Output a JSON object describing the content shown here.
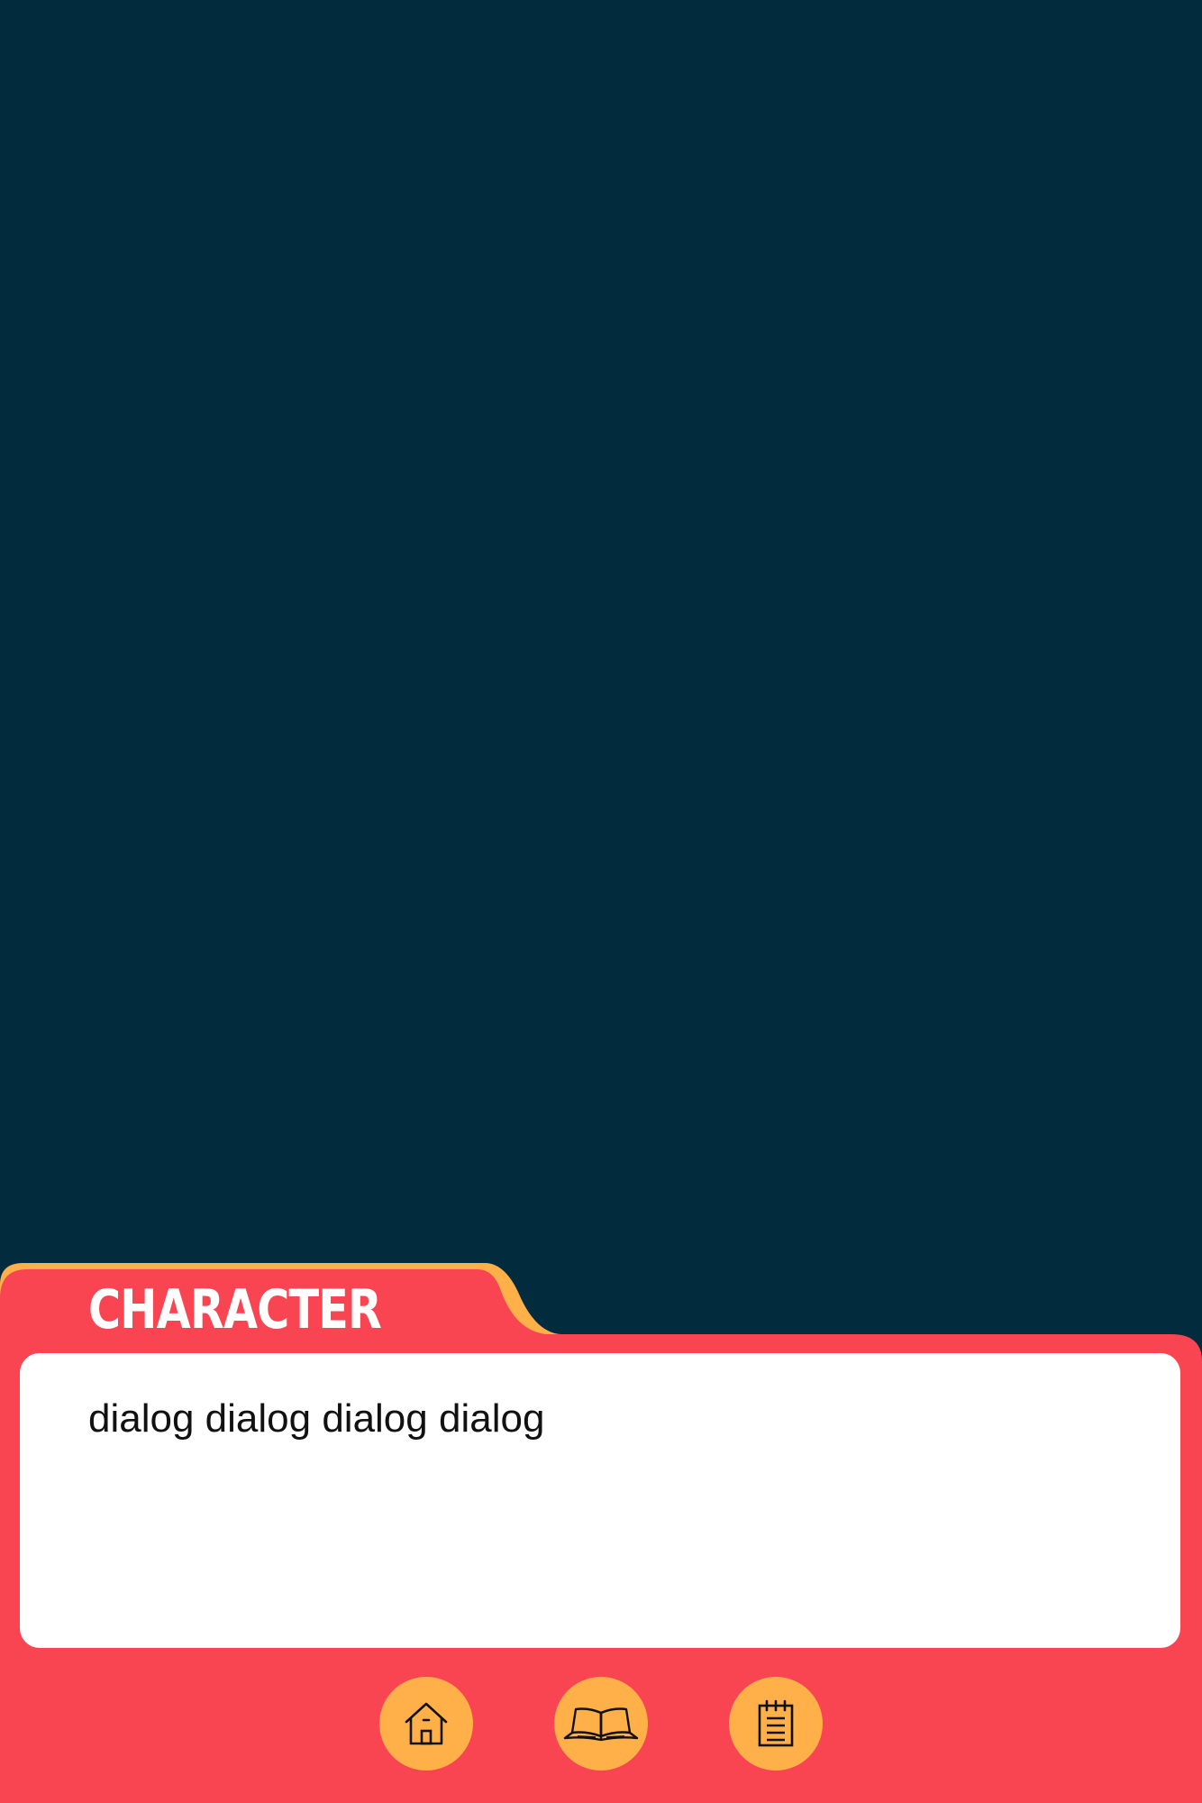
{
  "speaker": {
    "name": "CHARACTER"
  },
  "dialog": {
    "text": "dialog dialog dialog dialog"
  },
  "menu": {
    "buttons": [
      {
        "icon": "home-icon"
      },
      {
        "icon": "book-icon"
      },
      {
        "icon": "notepad-icon"
      }
    ]
  },
  "colors": {
    "background": "#022b3e",
    "panel": "#f94552",
    "accent": "#ffb049",
    "dialog_bg": "#ffffff",
    "text": "#111111"
  }
}
